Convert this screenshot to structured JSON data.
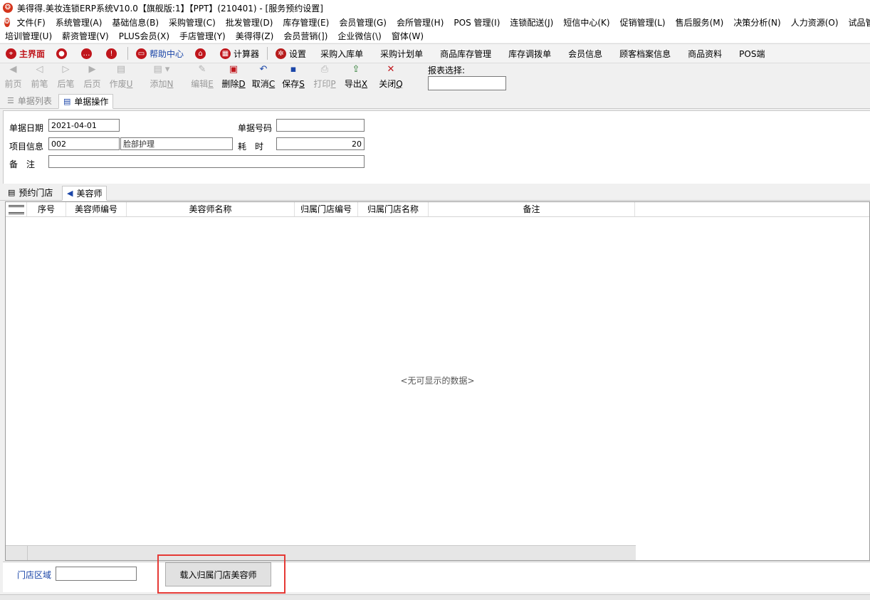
{
  "window": {
    "title": "美得得.美妆连锁ERP系统V10.0【旗舰版:1】【PPT】(210401) - [服务预约设置]"
  },
  "menu_row1": [
    "文件(F)",
    "系统管理(A)",
    "基础信息(B)",
    "采购管理(C)",
    "批发管理(D)",
    "库存管理(E)",
    "会员管理(G)",
    "会所管理(H)",
    "POS 管理(I)",
    "连锁配送(J)",
    "短信中心(K)",
    "促销管理(L)",
    "售后服务(M)",
    "决策分析(N)",
    "人力资源(O)",
    "试品管理"
  ],
  "menu_row2": [
    "培训管理(U)",
    "薪资管理(V)",
    "PLUS会员(X)",
    "手店管理(Y)",
    "美得得(Z)",
    "会员营销(])",
    "企业微信(\\)",
    "窗体(W)"
  ],
  "quickbar": {
    "home": "主界面",
    "help": "帮助中心",
    "calculator": "计算器",
    "settings": "设置",
    "links": [
      "采购入库单",
      "采购计划单",
      "商品库存管理",
      "库存调拨单",
      "会员信息",
      "顾客档案信息",
      "商品资料",
      "POS端"
    ]
  },
  "actions": {
    "first": {
      "label": "前页",
      "key": ""
    },
    "prev": {
      "label": "前笔",
      "key": ""
    },
    "next": {
      "label": "后笔",
      "key": ""
    },
    "last": {
      "label": "后页",
      "key": ""
    },
    "void": {
      "label": "作废",
      "key": "U"
    },
    "add": {
      "label": "添加",
      "key": "N"
    },
    "edit": {
      "label": "编辑",
      "key": "E"
    },
    "delete": {
      "label": "删除",
      "key": "D"
    },
    "cancel": {
      "label": "取消",
      "key": "C"
    },
    "save": {
      "label": "保存",
      "key": "S"
    },
    "print": {
      "label": "打印",
      "key": "P"
    },
    "export": {
      "label": "导出",
      "key": "X"
    },
    "close": {
      "label": "关闭",
      "key": "Q"
    },
    "report_select_label": "报表选择:"
  },
  "tabs_top": {
    "list": "单据列表",
    "operate": "单据操作"
  },
  "form": {
    "date_label": "单据日期",
    "date_value": "2021-04-01",
    "docno_label": "单据号码",
    "docno_value": "",
    "item_label": "项目信息",
    "item_code": "002",
    "item_name": "脸部护理",
    "duration_label": "耗　时",
    "duration_value": "20",
    "remark_label": "备　注",
    "remark_value": ""
  },
  "tabs_mid": {
    "store": "预约门店",
    "beautician": "美容师"
  },
  "grid": {
    "columns": [
      "序号",
      "美容师编号",
      "美容师名称",
      "归属门店编号",
      "归属门店名称",
      "备注"
    ],
    "empty_text": "<无可显示的数据>"
  },
  "bottom": {
    "store_region_label": "门店区域",
    "store_region_value": "",
    "load_button": "载入归属门店美容师"
  }
}
